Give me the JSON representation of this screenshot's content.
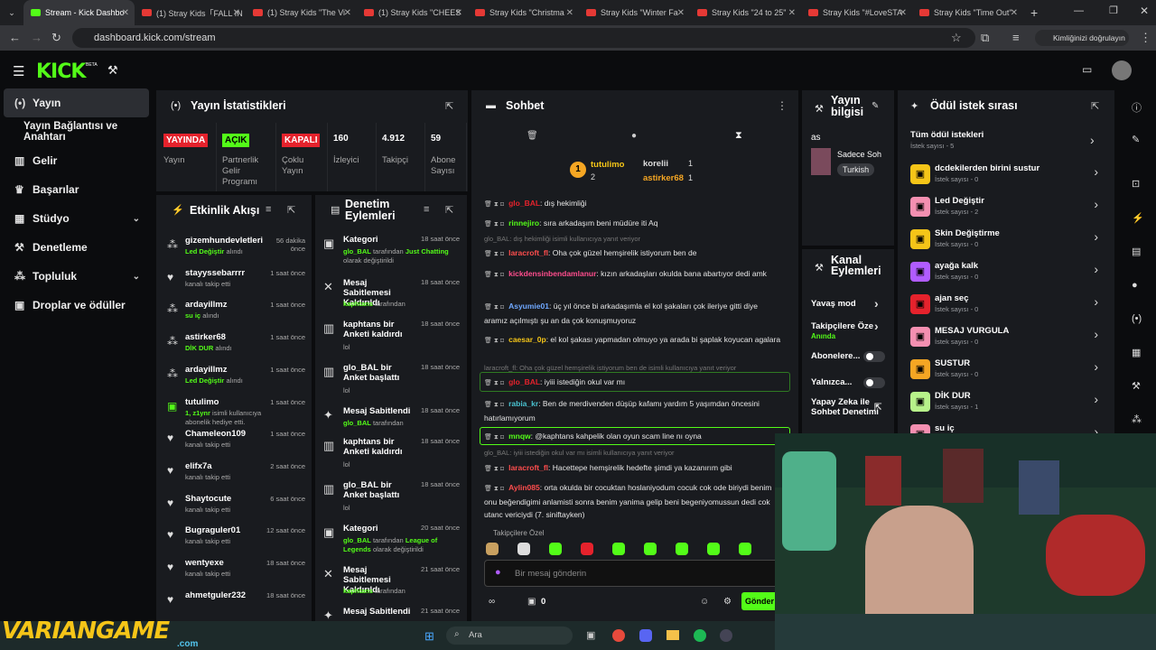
{
  "browser": {
    "tabs": [
      {
        "label": "Stream - Kick Dashbo",
        "active": true
      },
      {
        "label": "(1) Stray Kids「FALL IN"
      },
      {
        "label": "(1) Stray Kids \"The Vi"
      },
      {
        "label": "(1) Stray Kids \"CHEES"
      },
      {
        "label": "Stray Kids \"Christma"
      },
      {
        "label": "Stray Kids \"Winter Fa"
      },
      {
        "label": "Stray Kids \"24 to 25\""
      },
      {
        "label": "Stray Kids \"#LoveSTA"
      },
      {
        "label": "Stray Kids \"Time Out\""
      }
    ],
    "url": "dashboard.kick.com/stream",
    "verify_label": "Kimliğinizi doğrulayın"
  },
  "header": {
    "logo": "KICK",
    "beta": "BETA"
  },
  "sidebar": {
    "items": [
      {
        "label": "Yayın",
        "icon": "broadcast-icon"
      },
      {
        "label": "Yayın Bağlantısı ve Anahtarı"
      },
      {
        "label": "Gelir",
        "icon": "chart-icon"
      },
      {
        "label": "Başarılar",
        "icon": "trophy-icon"
      },
      {
        "label": "Stüdyo",
        "icon": "grid-icon"
      },
      {
        "label": "Denetleme",
        "icon": "wrench-icon"
      },
      {
        "label": "Topluluk",
        "icon": "users-icon"
      },
      {
        "label": "Droplar ve ödüller",
        "icon": "gift-icon"
      }
    ]
  },
  "stats": {
    "title": "Yayın İstatistikleri",
    "items": [
      {
        "badge": "YAYINDA",
        "label": "Yayın",
        "color": "#e5222c"
      },
      {
        "badge": "AÇIK",
        "label": "Partnerlik Gelir Programı",
        "color": "#53fc18"
      },
      {
        "badge": "KAPALI",
        "label": "Çoklu Yayın",
        "color": "#e5222c"
      },
      {
        "value": "160",
        "label": "İzleyici"
      },
      {
        "value": "4.912",
        "label": "Takipçi"
      },
      {
        "value": "59",
        "label": "Abone Sayısı"
      }
    ]
  },
  "activity": {
    "title": "Etkinlik Akışı",
    "items": [
      {
        "name": "gizemhundevletleri",
        "desc": "Led Değiştir",
        "suffix": "alındı",
        "time": "56 dakika önce",
        "icon": "users-icon"
      },
      {
        "name": "stayyssebarrrr",
        "desc": "kanalı takip etti",
        "time": "1 saat önce",
        "icon": "heart-icon"
      },
      {
        "name": "ardayillmz",
        "desc": "su iç",
        "suffix": "alındı",
        "time": "1 saat önce",
        "icon": "users-icon"
      },
      {
        "name": "astirker68",
        "desc": "DİK DUR",
        "suffix": "alındı",
        "time": "1 saat önce",
        "icon": "users-icon"
      },
      {
        "name": "ardayillmz",
        "desc": "Led Değiştir",
        "suffix": "alındı",
        "time": "1 saat önce",
        "icon": "users-icon"
      },
      {
        "name": "tutulimo",
        "desc": "1, z1ynr",
        "suffix": "isimli kullanıcıya abonelik hediye etti.",
        "time": "1 saat önce",
        "icon": "gift-icon"
      },
      {
        "name": "Chameleon109",
        "desc": "kanalı takip etti",
        "time": "1 saat önce",
        "icon": "heart-icon"
      },
      {
        "name": "elifx7a",
        "desc": "kanalı takip etti",
        "time": "2 saat önce",
        "icon": "heart-icon"
      },
      {
        "name": "Shaytocute",
        "desc": "kanalı takip etti",
        "time": "6 saat önce",
        "icon": "heart-icon"
      },
      {
        "name": "Bugraguler01",
        "desc": "kanalı takip etti",
        "time": "12 saat önce",
        "icon": "heart-icon"
      },
      {
        "name": "wentyexe",
        "desc": "kanalı takip etti",
        "time": "18 saat önce",
        "icon": "heart-icon"
      },
      {
        "name": "ahmetguler232",
        "desc": "",
        "time": "18 saat önce",
        "icon": "heart-icon"
      }
    ]
  },
  "moderation": {
    "title": "Denetim Eylemleri",
    "items": [
      {
        "action": "Kategori",
        "by": "glo_BAL",
        "mid": "tarafından",
        "extra": "Just Chatting",
        "tail": "olarak değiştirildi",
        "time": "18 saat önce"
      },
      {
        "action": "Mesaj Sabitlemesi Kaldırıldı",
        "by": "kaphtans",
        "mid": "tarafından",
        "time": "18 saat önce"
      },
      {
        "action": "kaphtans bir Anketi kaldırdı",
        "sub": "lol",
        "time": "18 saat önce"
      },
      {
        "action": "glo_BAL bir Anket başlattı",
        "sub": "lol",
        "time": "18 saat önce"
      },
      {
        "action": "Mesaj Sabitlendi",
        "by": "glo_BAL",
        "mid": "tarafından",
        "time": "18 saat önce"
      },
      {
        "action": "kaphtans bir Anketi kaldırdı",
        "sub": "lol",
        "time": "18 saat önce"
      },
      {
        "action": "glo_BAL bir Anket başlattı",
        "sub": "lol",
        "time": "18 saat önce"
      },
      {
        "action": "Kategori",
        "by": "glo_BAL",
        "mid": "tarafından",
        "extra": "League of Legends",
        "tail": "olarak değiştirildi",
        "time": "20 saat önce"
      },
      {
        "action": "Mesaj Sabitlemesi Kaldırıldı",
        "by": "kaphtans",
        "mid": "tarafından",
        "time": "21 saat önce"
      },
      {
        "action": "Mesaj Sabitlendi",
        "time": "21 saat önce"
      }
    ]
  },
  "chat": {
    "title": "Sohbet",
    "leaderboard": {
      "first": "tutulimo",
      "first_count": "2",
      "second": "korelii",
      "second_count": "1",
      "third": "astirker68",
      "third_count": "1"
    },
    "messages": [
      {
        "user": "glo_BAL",
        "text": ": dış hekimliği",
        "color": "#e5222c"
      },
      {
        "user": "rinnejiro",
        "text": ": sıra arkadaşım beni müdüre iti Aq",
        "color": "#53fc18"
      },
      {
        "reply": "glo_BAL: dış hekimliği isimli kullanıcıya yanıt veriyor"
      },
      {
        "user": "laracroft_fl",
        "text": ": Oha çok güzel hemşirelik istiyorum ben de",
        "color": "#ff4d4d"
      },
      {
        "user": "kickdensinbendamlanur",
        "text": ": kızın arkadaşları okulda bana abartıyor dedi amk",
        "color": "#ff4d8d"
      },
      {
        "user": "Asyumie01",
        "text": ": üç yıl önce bi arkadaşımla el kol şakaları çok ileriye gitti diye aramız açılmıştı şu an da çok konuşmuyoruz",
        "color": "#6fa8ff"
      },
      {
        "user": "caesar_0p",
        "text": ": el kol şakası yapmadan olmuyo ya arada bi şaplak koyucan agalara",
        "color": "#f5c518"
      },
      {
        "reply": "laracroft_fl: Oha çok güzel hemşirelik istiyorum ben de isimli kullanıcıya yanıt veriyor"
      },
      {
        "user": "glo_BAL",
        "text": ": iyiii istediğin okul var mı",
        "color": "#e5222c"
      },
      {
        "user": "rabia_kr",
        "text": ": Ben de merdivenden düşüp kafamı yardım 5 yaşımdan öncesini hatırlamıyorum",
        "color": "#49c2d0"
      },
      {
        "user": "mnqw",
        "text": ": @kaphtans kahpelik olan oyun scam line nı oyna",
        "color": "#53fc18"
      },
      {
        "reply": "glo_BAL: iyiii istediğin okul var mı isimli kullanıcıya yanıt veriyor"
      },
      {
        "user": "laracroft_fl",
        "text": ": Hacettepe hemşirelik hedefte şimdi ya kazanırım gibi",
        "color": "#ff4d4d"
      },
      {
        "user": "Aylin085",
        "text": ": orta okulda bir cocuktan hoslaniyodum cocuk cok ode biriydi benim onu beğendigimi anlamisti sonra benim yanima gelip beni begeniyomussun dedi cok utanc vericiydi (7. siniftayken)",
        "color": "#ff4d4d"
      }
    ],
    "emote_label": "Takipçilere Özel",
    "input_placeholder": "Bir mesaj gönderin",
    "send_label": "Gönder",
    "points": "0"
  },
  "stream_info": {
    "title": "Yayın bilgisi",
    "name": "as",
    "tag1": "Sadece Soh",
    "tag2": "Turkish"
  },
  "channel_actions": {
    "title": "Kanal Eylemleri",
    "items": [
      {
        "label": "Yavaş mod"
      },
      {
        "label": "Takipçilere Öze",
        "sub": "Anında"
      },
      {
        "label": "Abonelere..."
      },
      {
        "label": "Yalnızca..."
      },
      {
        "label": "Yapay Zeka ile Sohbet Denetimi"
      }
    ]
  },
  "rewards": {
    "title": "Ödül istek sırası",
    "all_label": "Tüm ödül istekleri",
    "all_count": "İstek sayısı - 5",
    "items": [
      {
        "name": "dcdekilerden birini sustur",
        "count": "İstek sayısı - 0",
        "color": "#f5c518"
      },
      {
        "name": "Led Değiştir",
        "count": "İstek sayısı - 2",
        "color": "#f48fb1"
      },
      {
        "name": "Skin Değiştirme",
        "count": "İstek sayısı - 0",
        "color": "#f5c518"
      },
      {
        "name": "ayağa kalk",
        "count": "İstek sayısı - 0",
        "color": "#b05cff"
      },
      {
        "name": "ajan seç",
        "count": "İstek sayısı - 0",
        "color": "#e5222c"
      },
      {
        "name": "MESAJ VURGULA",
        "count": "İstek sayısı - 0",
        "color": "#f48fb1"
      },
      {
        "name": "SUSTUR",
        "count": "İstek sayısı - 0",
        "color": "#f5a623"
      },
      {
        "name": "DİK DUR",
        "count": "İstek sayısı - 1",
        "color": "#b7f28a"
      },
      {
        "name": "su iç",
        "count": "",
        "color": "#f48fb1"
      }
    ]
  },
  "taskbar": {
    "search": "Ara"
  },
  "watermark": {
    "text": "VARIANGAME",
    "sub": ".com"
  }
}
